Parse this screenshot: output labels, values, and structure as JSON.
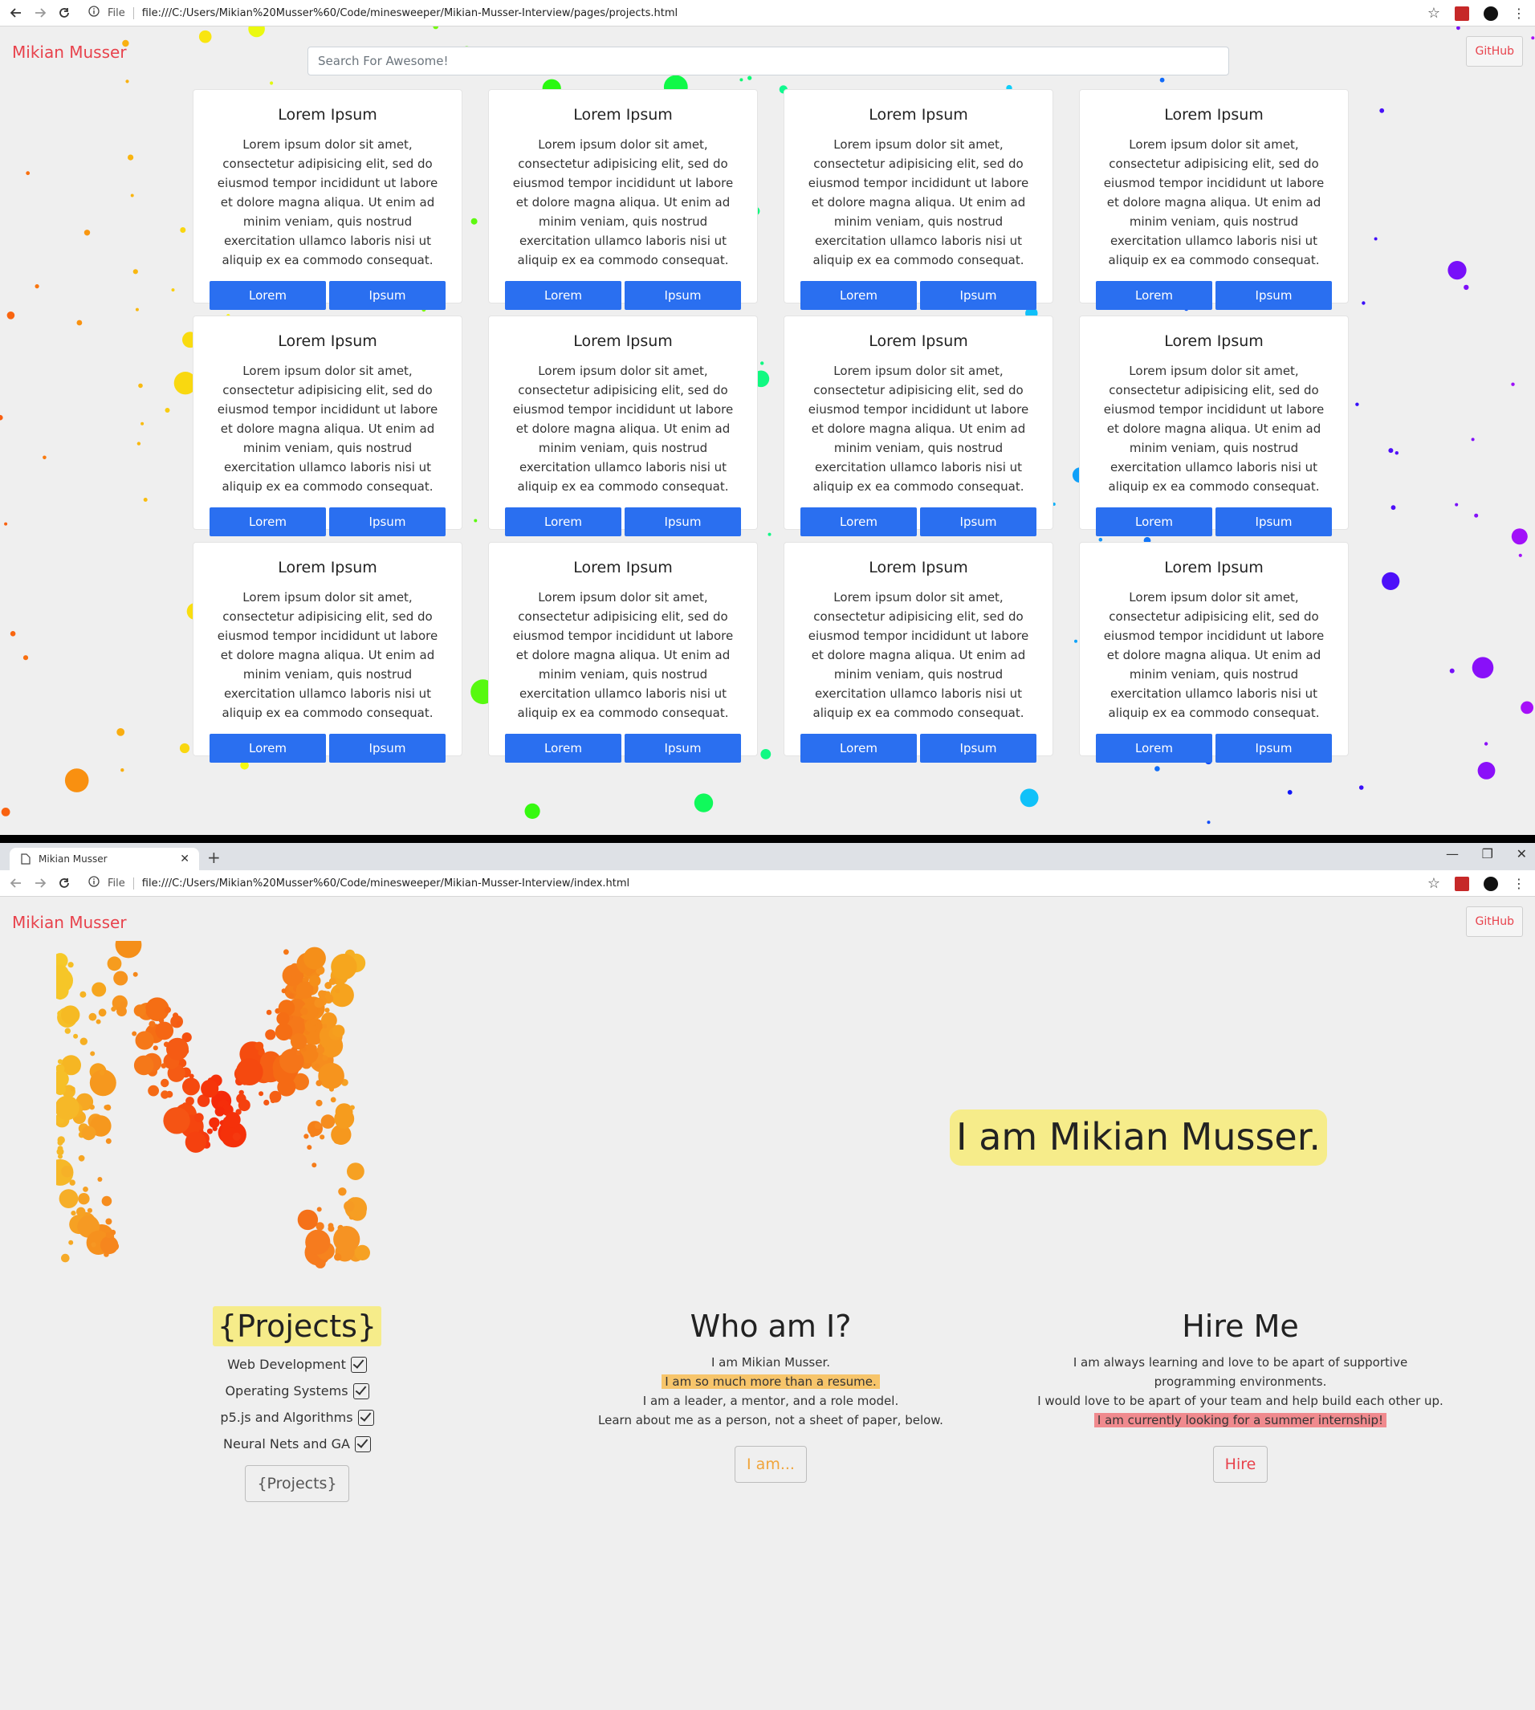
{
  "browser_top": {
    "url_scheme": "File",
    "url": "file:///C:/Users/Mikian%20Musser%60/Code/minesweeper/Mikian-Musser-Interview/pages/projects.html"
  },
  "browser_bottom": {
    "tab_title": "Mikian Musser",
    "url_scheme": "File",
    "url": "file:///C:/Users/Mikian%20Musser%60/Code/minesweeper/Mikian-Musser-Interview/index.html"
  },
  "nav": {
    "brand": "Mikian Musser",
    "github": "GitHub"
  },
  "projects_page": {
    "search_placeholder": "Search For Awesome!",
    "card_title": "Lorem Ipsum",
    "card_text": "Lorem ipsum dolor sit amet, consectetur adipisicing elit, sed do eiusmod tempor incididunt ut labore et dolore magna aliqua. Ut enim ad minim veniam, quis nostrud exercitation ullamco laboris nisi ut aliquip ex ea commodo consequat.",
    "btn1": "Lorem",
    "btn2": "Ipsum",
    "card_count": 12
  },
  "index_page": {
    "hero": "I am Mikian Musser.",
    "projects": {
      "title": "{Projects}",
      "items": [
        "Web Development",
        "Operating Systems",
        "p5.js and Algorithms",
        "Neural Nets and GA"
      ],
      "button": "{Projects}"
    },
    "who": {
      "title": "Who am I?",
      "line1": "I am Mikian Musser.",
      "line2": "I am so much more than a resume.",
      "line3": "I am a leader, a mentor, and a role model.",
      "line4": "Learn about me as a person, not a sheet of paper, below.",
      "button": "I am..."
    },
    "hire": {
      "title": "Hire Me",
      "line1": "I am always learning and love to be apart of supportive programming environments.",
      "line2": "I would love to be apart of your team and help build each other up.",
      "line3": "I am currently looking for a summer internship!",
      "button": "Hire"
    }
  },
  "colors": {
    "brand": "#e8424c",
    "primary_button": "#2a6ff0",
    "highlight_yellow": "#f6ec8a",
    "highlight_orange": "#f7c56b",
    "highlight_red": "#f08a8e",
    "i_am_button_text": "#f0a43a",
    "hire_button_text": "#e8424c",
    "projects_button_text": "#555555"
  },
  "icons": [
    "back-arrow-icon",
    "forward-arrow-icon",
    "reload-icon",
    "info-icon",
    "star-icon",
    "kebab-menu-icon",
    "page-icon",
    "close-icon",
    "checkbox-icon"
  ]
}
